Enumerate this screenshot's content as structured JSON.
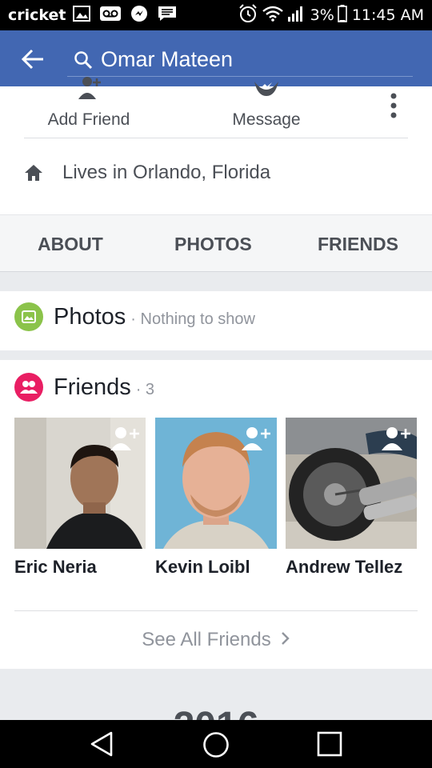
{
  "status_bar": {
    "carrier": "cricket",
    "battery": "3%",
    "time": "11:45 AM",
    "icons": [
      "image-icon",
      "voicemail-icon",
      "messenger-icon",
      "chat-icon",
      "alarm-icon",
      "wifi-icon",
      "signal-icon",
      "battery-icon"
    ]
  },
  "header": {
    "search_value": "Omar Mateen",
    "accent_color": "#4267b2"
  },
  "profile": {
    "add_friend_label": "Add Friend",
    "message_label": "Message",
    "lives_in": "Lives in Orlando, Florida"
  },
  "tabs": [
    {
      "label": "ABOUT"
    },
    {
      "label": "PHOTOS"
    },
    {
      "label": "FRIENDS"
    }
  ],
  "photos_section": {
    "title": "Photos",
    "subtitle": "· Nothing to show"
  },
  "friends_section": {
    "title": "Friends",
    "count": "· 3",
    "friends": [
      {
        "name": "Eric Neria"
      },
      {
        "name": "Kevin Loibl"
      },
      {
        "name": "Andrew Tellez"
      }
    ],
    "see_all": "See All Friends"
  },
  "year_heading": "2016",
  "nav_bar": {
    "icons": [
      "back-triangle-icon",
      "home-circle-icon",
      "recents-square-icon"
    ]
  }
}
